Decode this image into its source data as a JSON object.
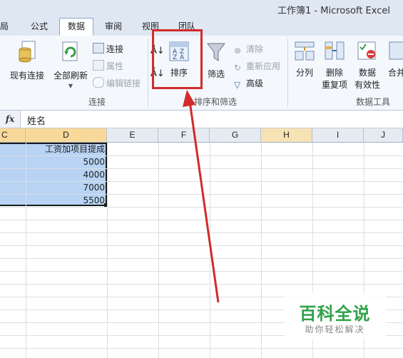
{
  "window": {
    "title": "工作簿1 - Microsoft Excel"
  },
  "tabs": [
    {
      "label": "局",
      "active": false
    },
    {
      "label": "公式",
      "active": false
    },
    {
      "label": "数据",
      "active": true
    },
    {
      "label": "审阅",
      "active": false
    },
    {
      "label": "视图",
      "active": false
    },
    {
      "label": "团队",
      "active": false
    }
  ],
  "ribbon": {
    "connections_group": {
      "label": "连接",
      "existing_connections": "现有连接",
      "refresh_all": "全部刷新",
      "connections": "连接",
      "properties": "属性",
      "edit_links": "编辑链接"
    },
    "sort_filter_group": {
      "label": "排序和筛选",
      "sort": "排序",
      "filter": "筛选",
      "clear": "清除",
      "reapply": "重新应用",
      "advanced": "高级"
    },
    "data_tools_group": {
      "label": "数据工具",
      "text_to_columns": "分列",
      "remove_duplicates_1": "删除",
      "remove_duplicates_2": "重复项",
      "data_validation_1": "数据",
      "data_validation_2": "有效性",
      "consolidate": "合并"
    }
  },
  "formula_bar": {
    "fx_label": "fx",
    "value": "姓名"
  },
  "columns": [
    "C",
    "D",
    "E",
    "F",
    "G",
    "H",
    "I",
    "J"
  ],
  "sheet": {
    "d_header": "工资加项目提成",
    "d_values": [
      "5000",
      "4000",
      "7000",
      "5500"
    ]
  },
  "watermark": {
    "title": "百科全说",
    "subtitle": "助你轻松解决"
  },
  "colors": {
    "highlight_red": "#d32a2a",
    "selection_blue": "#b8d3f3",
    "ribbon_bg": "#f4f8fd",
    "tab_bg": "#dfe7f3"
  }
}
